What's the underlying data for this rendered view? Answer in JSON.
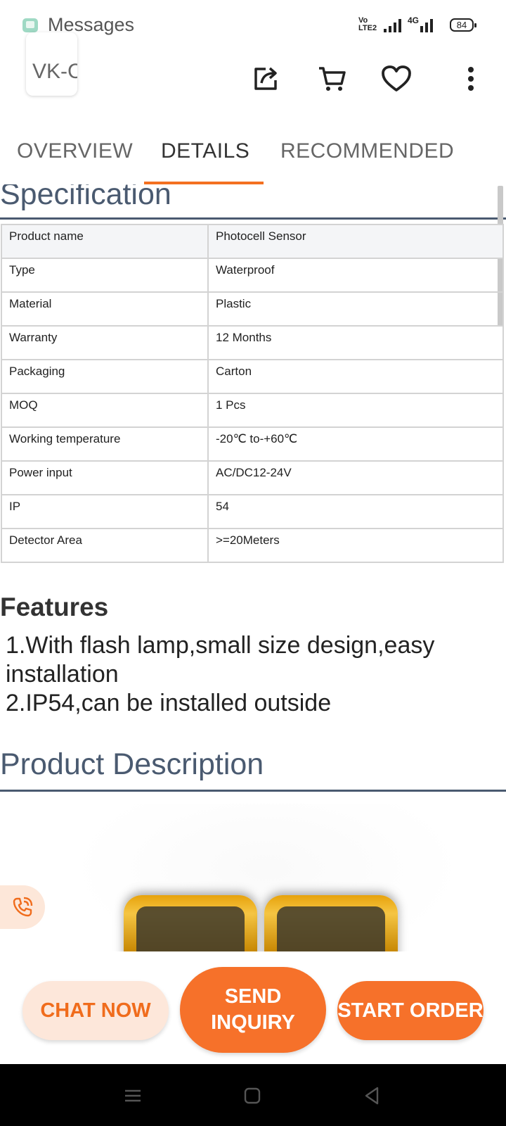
{
  "status_bar": {
    "notification_app": "Messages",
    "volte_label": "Vo LTE2",
    "network_label": "4G",
    "battery_level": "84"
  },
  "header": {
    "app_chip_text": "VK-C Ch",
    "icons": [
      "share-icon",
      "cart-icon",
      "heart-icon",
      "more-vertical-icon"
    ]
  },
  "tabs": [
    {
      "label": "OVERVIEW",
      "active": false
    },
    {
      "label": "DETAILS",
      "active": true
    },
    {
      "label": "RECOMMENDED",
      "active": false
    }
  ],
  "specification": {
    "heading": "Specification",
    "rows": [
      {
        "key": "Product name",
        "value": "Photocell Sensor"
      },
      {
        "key": "Type",
        "value": "Waterproof"
      },
      {
        "key": "Material",
        "value": "Plastic"
      },
      {
        "key": "Warranty",
        "value": "12 Months"
      },
      {
        "key": "Packaging",
        "value": "Carton"
      },
      {
        "key": "MOQ",
        "value": "1 Pcs"
      },
      {
        "key": "Working temperature",
        "value": "-20℃ to-+60℃"
      },
      {
        "key": "Power input",
        "value": "AC/DC12-24V"
      },
      {
        "key": "IP",
        "value": "54"
      },
      {
        "key": "Detector Area",
        "value": ">=20Meters"
      }
    ]
  },
  "features": {
    "heading": "Features",
    "items": [
      "1.With flash lamp,small size design,easy installation",
      "2.IP54,can be installed outside"
    ]
  },
  "product_description": {
    "heading": "Product Description"
  },
  "actions": {
    "chat_label": "CHAT NOW",
    "inquiry_label": "SEND INQUIRY",
    "order_label": "START ORDER"
  },
  "colors": {
    "accent": "#f6712a",
    "heading": "#4a5a70",
    "chat_bg": "#fde7da"
  }
}
